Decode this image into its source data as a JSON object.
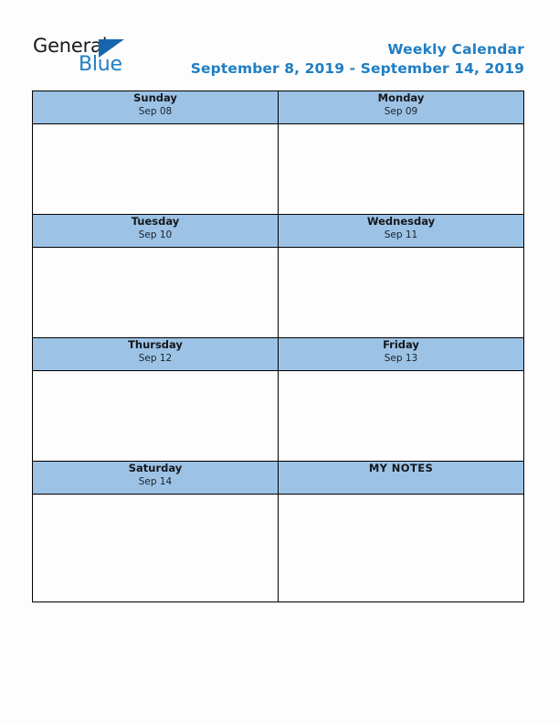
{
  "brand": {
    "name_part1": "General",
    "name_part2": "Blue",
    "triangle_icon": "triangle-icon",
    "color_dark": "#17181c",
    "color_blue": "#1f7ec4"
  },
  "header": {
    "title": "Weekly Calendar",
    "date_range": "September 8, 2019 - September 14, 2019",
    "title_color": "#1f7ec4"
  },
  "theme": {
    "header_cell_bg": "#9cc3e5",
    "border_color": "#000000",
    "page_bg": "#fdfdfd",
    "text_color": "#15181d"
  },
  "calendar": {
    "rows": [
      {
        "cells": [
          {
            "day": "Sunday",
            "date": "Sep 08",
            "entries": ""
          },
          {
            "day": "Monday",
            "date": "Sep 09",
            "entries": ""
          }
        ]
      },
      {
        "cells": [
          {
            "day": "Tuesday",
            "date": "Sep 10",
            "entries": ""
          },
          {
            "day": "Wednesday",
            "date": "Sep 11",
            "entries": ""
          }
        ]
      },
      {
        "cells": [
          {
            "day": "Thursday",
            "date": "Sep 12",
            "entries": ""
          },
          {
            "day": "Friday",
            "date": "Sep 13",
            "entries": ""
          }
        ]
      },
      {
        "cells": [
          {
            "day": "Saturday",
            "date": "Sep 14",
            "entries": ""
          },
          {
            "day": "MY NOTES",
            "date": "",
            "entries": ""
          }
        ]
      }
    ]
  }
}
